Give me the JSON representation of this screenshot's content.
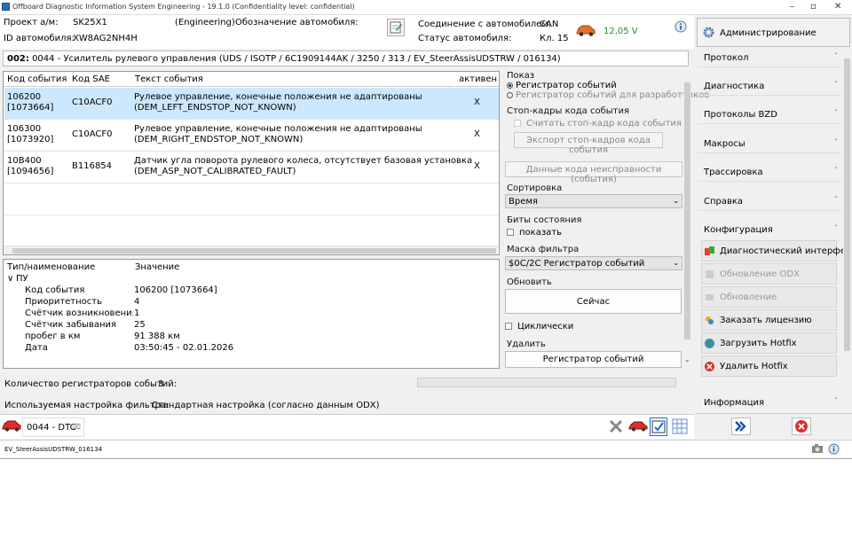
{
  "window": {
    "title": "Offboard Diagnostic Information System Engineering - 19.1.0 (Confidentiality level: confidential)"
  },
  "header": {
    "project_label": "Проект а/м:",
    "project_value": "SK25X1",
    "mode": "(Engineering)",
    "vehicle_designation_label": "Обозначение автомобиля:",
    "vin_label": "ID автомобиля:",
    "vin_value": "XW8AG2NH4H",
    "connection_label": "Соединение с автомобилем:",
    "connection_value": "CAN",
    "status_label": "Статус автомобиля:",
    "status_value": "Кл. 15",
    "voltage": "12,05 V",
    "voltage_color": "#2a8a2a"
  },
  "admin_button": "Администрирование",
  "ecu_line": {
    "id": "002:",
    "text": "0044 - Усилитель рулевого управления  (UDS / ISOTP / 6C1909144AK / 3250 / 313 / EV_SteerAssisUDSTRW / 016134)"
  },
  "events_table": {
    "headers": [
      "Код события",
      "Код SAE",
      "Текст события",
      "активен"
    ],
    "rows": [
      {
        "code1": "106200",
        "code2": "[1073664]",
        "sae": "C10ACF0",
        "text1": "Рулевое управление, конечные положения не адаптированы",
        "text2": "(DEM_LEFT_ENDSTOP_NOT_KNOWN)",
        "active": "X"
      },
      {
        "code1": "106300",
        "code2": "[1073920]",
        "sae": "C10ACF0",
        "text1": "Рулевое управление, конечные положения не адаптированы",
        "text2": "(DEM_RIGHT_ENDSTOP_NOT_KNOWN)",
        "active": "X"
      },
      {
        "code1": "10B400",
        "code2": "[1094656]",
        "sae": "B116854",
        "text1": "Датчик угла поворота рулевого колеса, отсутствует базовая установка",
        "text2": "(DEM_ASP_NOT_CALIBRATED_FAULT)",
        "active": "X"
      }
    ]
  },
  "detail": {
    "headers": [
      "Тип/наименование",
      "Значение"
    ],
    "group": "ПУ",
    "rows": [
      {
        "name": "Код события",
        "value": "106200 [1073664]"
      },
      {
        "name": "Приоритетность",
        "value": "4"
      },
      {
        "name": "Счётчик возникновения ош",
        "value": "1"
      },
      {
        "name": "Счётчик забывания",
        "value": "25"
      },
      {
        "name": "пробег в км",
        "value": "91 388 км"
      },
      {
        "name": "Дата",
        "value": "03:50:45 - 02.01.2026"
      }
    ]
  },
  "right_panel": {
    "show_label": "Показ",
    "event_memory": "Регистратор событий",
    "dev_event_memory": "Регистратор событий для разработчиков",
    "freeze_label": "Стоп-кадры кода события",
    "read_freeze": "Считать стоп-кадр кода события",
    "export_freeze": "Экспорт стоп-кадров кода события",
    "fault_data": "Данные кода неисправности (события)",
    "sort_label": "Сортировка",
    "sort_value": "Время",
    "status_bits_label": "Биты состояния",
    "show_checkbox": "показать",
    "filter_mask_label": "Маска фильтра",
    "filter_mask_value": "$0C/2C Регистратор событий",
    "refresh_label": "Обновить",
    "now_button": "Сейчас",
    "cyclic": "Циклически",
    "delete_label": "Удалить",
    "delete_button": "Регистратор событий"
  },
  "footer_info": {
    "count_label": "Количество регистраторов событий:",
    "count_value": "3",
    "filter_label": "Используемая настройка фильтра:",
    "filter_value": "Стандартная настройка (согласно данным ODX)"
  },
  "sidebar": {
    "items": [
      "Протокол",
      "Диагностика",
      "Протоколы BZD",
      "Макросы",
      "Трассировка",
      "Справка",
      "Конфигурация"
    ],
    "config_buttons": [
      {
        "label": "Диагностический интерфейс",
        "disabled": false
      },
      {
        "label": "Обновление ODX",
        "disabled": true
      },
      {
        "label": "Обновление",
        "disabled": true
      },
      {
        "label": "Заказать лицензию",
        "disabled": false
      },
      {
        "label": "Загрузить Hotfix",
        "disabled": false
      },
      {
        "label": "Удалить Hotfix",
        "disabled": false
      }
    ],
    "info": "Информация"
  },
  "tab": {
    "label": "0044 - DTC"
  },
  "statusbar": {
    "text": "EV_SteerAssisUDSTRW_016134"
  }
}
